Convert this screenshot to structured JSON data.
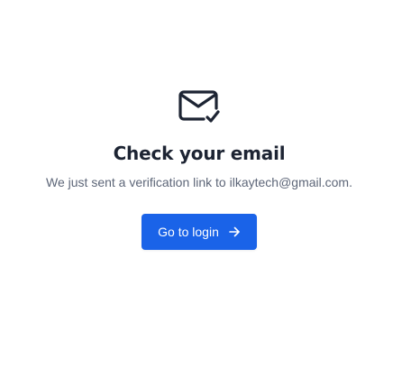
{
  "heading": "Check your email",
  "message": {
    "prefix": "We just sent a verification link to ",
    "email": "ilkaytech@gmail.com",
    "suffix": "."
  },
  "login_button": {
    "label": "Go to login"
  },
  "icons": {
    "mail": "mail-check-icon",
    "arrow": "arrow-right-icon"
  },
  "colors": {
    "primary": "#1a63e8",
    "heading": "#1d2433",
    "text": "#5d6678",
    "background": "#ffffff"
  }
}
